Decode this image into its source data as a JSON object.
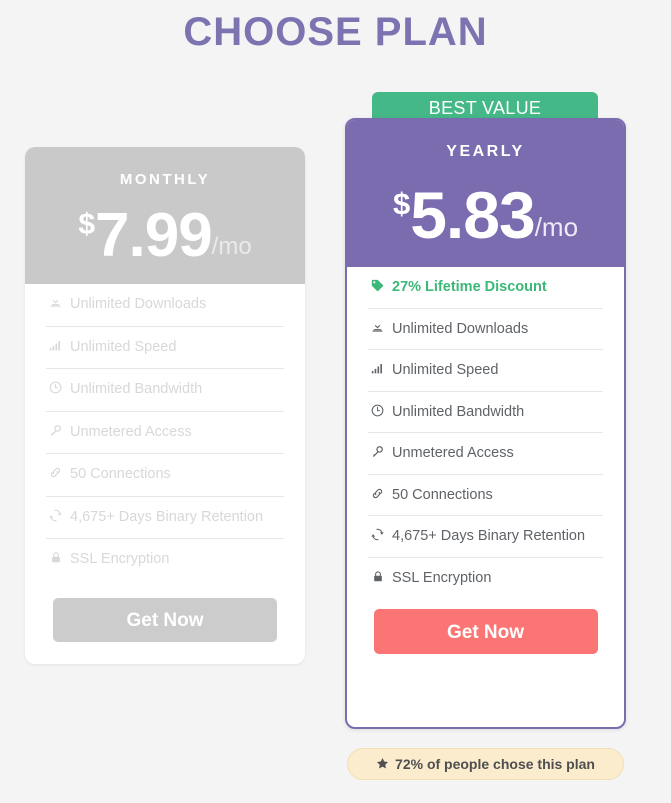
{
  "page": {
    "title": "CHOOSE PLAN",
    "background_color": "#f4f4f4",
    "title_color": "#7b74b0"
  },
  "plans": {
    "monthly": {
      "name": "MONTHLY",
      "currency": "$",
      "amount": "7.99",
      "period": "/mo",
      "header_color": "#c9c9c9",
      "button_label": "Get Now",
      "button_color": "#cccccc",
      "features": [
        {
          "icon": "download-icon",
          "label": "Unlimited Downloads"
        },
        {
          "icon": "signal-bars-icon",
          "label": "Unlimited Speed"
        },
        {
          "icon": "clock-icon",
          "label": "Unlimited Bandwidth"
        },
        {
          "icon": "key-icon",
          "label": "Unmetered Access"
        },
        {
          "icon": "link-icon",
          "label": "50 Connections"
        },
        {
          "icon": "refresh-icon",
          "label": "4,675+ Days Binary Retention"
        },
        {
          "icon": "lock-icon",
          "label": "SSL Encryption"
        }
      ]
    },
    "yearly": {
      "ribbon_label": "BEST VALUE",
      "ribbon_color": "#44b886",
      "name": "YEARLY",
      "currency": "$",
      "amount": "5.83",
      "period": "/mo",
      "header_color": "#7b6cb0",
      "button_label": "Get Now",
      "button_color": "#fb7575",
      "discount_color": "#3cb878",
      "features": [
        {
          "icon": "tag-icon",
          "label": "27% Lifetime Discount"
        },
        {
          "icon": "download-icon",
          "label": "Unlimited Downloads"
        },
        {
          "icon": "signal-bars-icon",
          "label": "Unlimited Speed"
        },
        {
          "icon": "clock-icon",
          "label": "Unlimited Bandwidth"
        },
        {
          "icon": "key-icon",
          "label": "Unmetered Access"
        },
        {
          "icon": "link-icon",
          "label": "50 Connections"
        },
        {
          "icon": "refresh-icon",
          "label": "4,675+ Days Binary Retention"
        },
        {
          "icon": "lock-icon",
          "label": "SSL Encryption"
        }
      ],
      "chose_badge": {
        "icon": "star-icon",
        "label": "72% of people chose this plan",
        "background_color": "#fbeccd"
      }
    }
  }
}
